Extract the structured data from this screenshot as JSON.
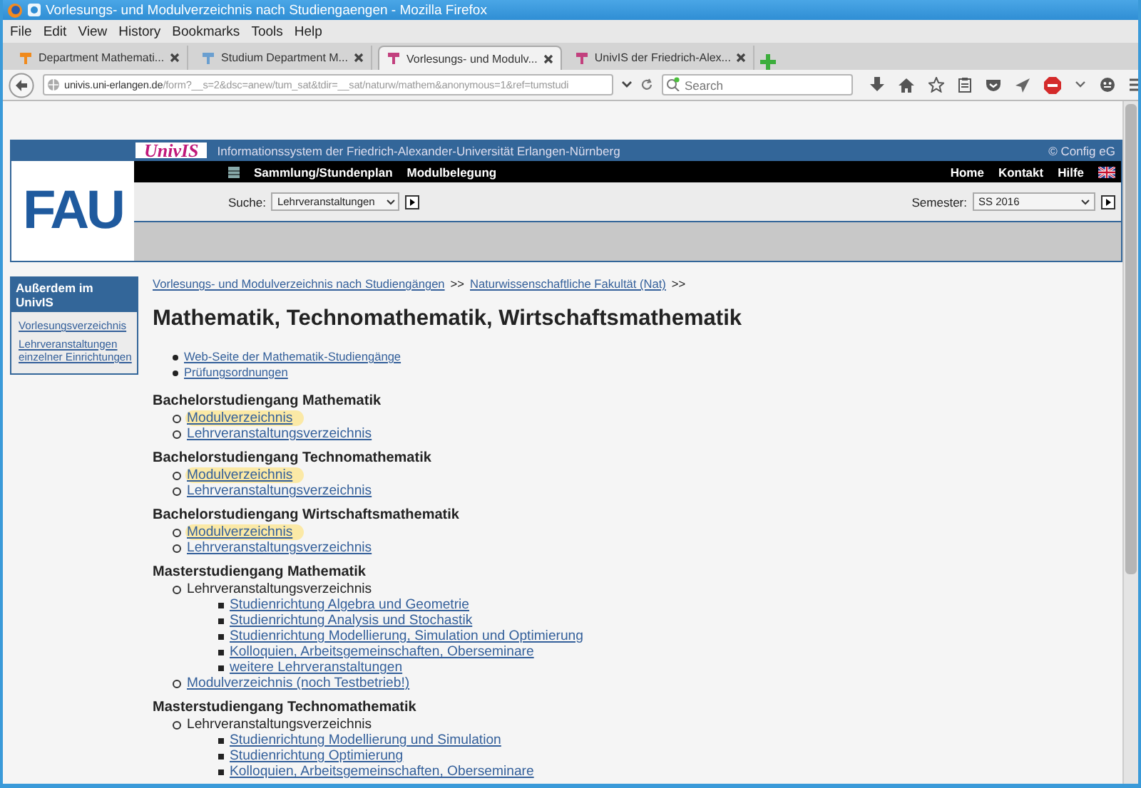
{
  "window": {
    "title": "Vorlesungs- und Modulverzeichnis nach Studiengaengen - Mozilla Firefox"
  },
  "menu": [
    "File",
    "Edit",
    "View",
    "History",
    "Bookmarks",
    "Tools",
    "Help"
  ],
  "tabs": [
    {
      "label": "Department Mathemati...",
      "selected": false,
      "color": "#f08a1c"
    },
    {
      "label": "Studium Department M...",
      "selected": false,
      "color": "#6a9fd0"
    },
    {
      "label": "Vorlesungs- und Modulv...",
      "selected": true,
      "color": "#c2407e"
    },
    {
      "label": "UnivIS der Friedrich-Alex...",
      "selected": false,
      "color": "#c2407e"
    }
  ],
  "address": {
    "host": "univis.uni-erlangen.de",
    "path": "/form?__s=2&dsc=anew/tum_sat&tdir=__sat/naturw/mathem&anonymous=1&ref=tumstudi"
  },
  "search": {
    "placeholder": "Search"
  },
  "univis": {
    "logo": "UnivIS",
    "info": "Informationssystem der Friedrich-Alexander-Universität Erlangen-Nürnberg",
    "copyright": "© Config eG",
    "fau_logo": "FAU",
    "nav_links": [
      "Sammlung/Stundenplan",
      "Modulbelegung"
    ],
    "right_links": [
      "Home",
      "Kontakt",
      "Hilfe"
    ],
    "search_label": "Suche:",
    "search_value": "Lehrveranstaltungen",
    "semester_label": "Semester:",
    "semester_value": "SS 2016"
  },
  "sidebar": {
    "title": "Außerdem im UnivIS",
    "links": [
      "Vorlesungsverzeichnis",
      "Lehrveranstaltungen einzelner Einrichtungen"
    ]
  },
  "breadcrumb": [
    {
      "kind": "link",
      "text": "Vorlesungs- und Modulverzeichnis nach Studiengängen"
    },
    {
      "kind": "text",
      "text": ">>"
    },
    {
      "kind": "link",
      "text": "Naturwissenschaftliche Fakultät (Nat)"
    },
    {
      "kind": "text",
      "text": ">>"
    }
  ],
  "heading": "Mathematik, Technomathematik, Wirtschaftsmathematik",
  "top_links": [
    "Web-Seite der Mathematik-Studiengänge",
    "Prüfungsordnungen"
  ],
  "sections": [
    {
      "heading": "Bachelorstudiengang Mathematik",
      "items": [
        {
          "kind": "link",
          "text": "Modulverzeichnis",
          "highlighted": true
        },
        {
          "kind": "link",
          "text": "Lehrveranstaltungsverzeichnis",
          "highlighted": false
        }
      ]
    },
    {
      "heading": "Bachelorstudiengang Technomathematik",
      "items": [
        {
          "kind": "link",
          "text": "Modulverzeichnis",
          "highlighted": true
        },
        {
          "kind": "link",
          "text": "Lehrveranstaltungsverzeichnis",
          "highlighted": false
        }
      ]
    },
    {
      "heading": "Bachelorstudiengang Wirtschaftsmathematik",
      "items": [
        {
          "kind": "link",
          "text": "Modulverzeichnis",
          "highlighted": true
        },
        {
          "kind": "link",
          "text": "Lehrveranstaltungsverzeichnis",
          "highlighted": false
        }
      ]
    },
    {
      "heading": "Masterstudiengang Mathematik",
      "items": [
        {
          "kind": "text",
          "text": "Lehrveranstaltungsverzeichnis",
          "highlighted": false,
          "children": [
            {
              "kind": "link",
              "text": "Studienrichtung Algebra und Geometrie",
              "highlighted": false
            },
            {
              "kind": "link",
              "text": "Studienrichtung Analysis und Stochastik",
              "highlighted": false
            },
            {
              "kind": "link",
              "text": "Studienrichtung Modellierung, Simulation und Optimierung",
              "highlighted": false
            },
            {
              "kind": "link",
              "text": "Kolloquien, Arbeitsgemeinschaften, Oberseminare",
              "highlighted": false
            },
            {
              "kind": "link",
              "text": "weitere Lehrveranstaltungen",
              "highlighted": false
            }
          ]
        },
        {
          "kind": "link",
          "text": "Modulverzeichnis (noch Testbetrieb!)",
          "highlighted": false
        }
      ]
    },
    {
      "heading": "Masterstudiengang Technomathematik",
      "items": [
        {
          "kind": "text",
          "text": "Lehrveranstaltungsverzeichnis",
          "highlighted": false,
          "children": [
            {
              "kind": "link",
              "text": "Studienrichtung Modellierung und Simulation",
              "highlighted": false
            },
            {
              "kind": "link",
              "text": "Studienrichtung Optimierung",
              "highlighted": false
            },
            {
              "kind": "link",
              "text": "Kolloquien, Arbeitsgemeinschaften, Oberseminare",
              "highlighted": false
            }
          ]
        }
      ]
    }
  ]
}
